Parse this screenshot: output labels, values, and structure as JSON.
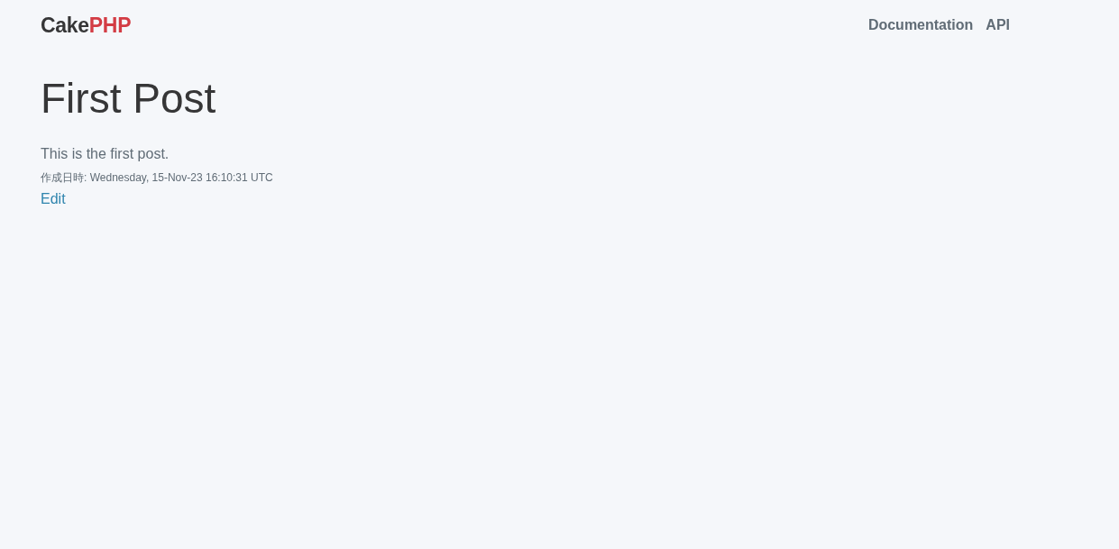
{
  "header": {
    "logo": {
      "text": "Cake",
      "accent": "PHP"
    },
    "nav": [
      {
        "label": "Documentation"
      },
      {
        "label": "API"
      }
    ]
  },
  "post": {
    "title": "First Post",
    "body": "This is the first post.",
    "created": "作成日時: Wednesday, 15-Nov-23 16:10:31 UTC",
    "edit_link": "Edit"
  }
}
